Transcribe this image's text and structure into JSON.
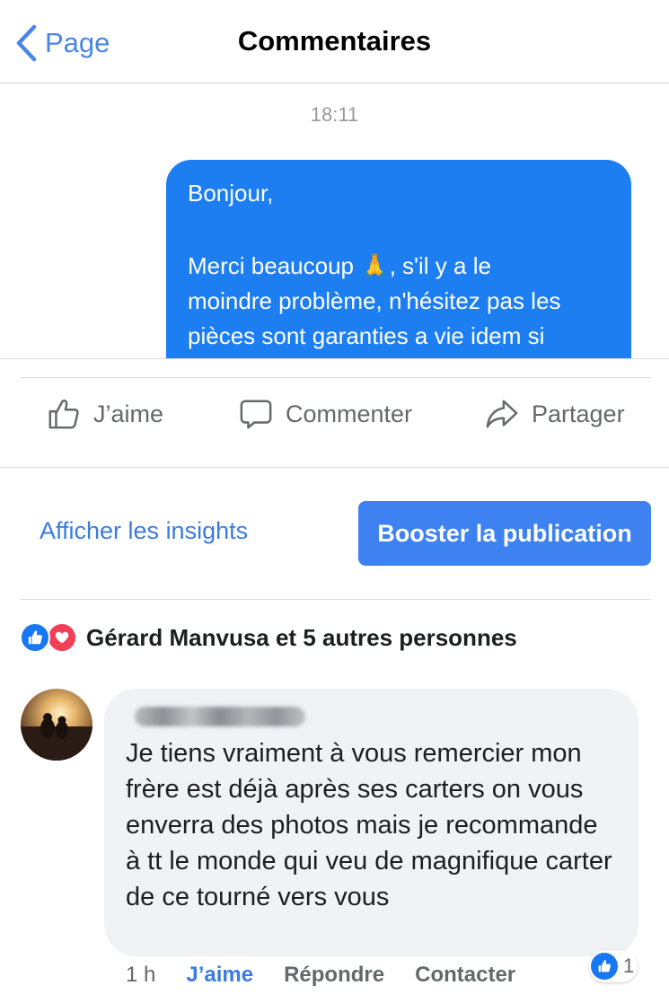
{
  "nav": {
    "back_label": "Page",
    "title": "Commentaires"
  },
  "preview": {
    "time": "18:11",
    "message_lines": [
      "Bonjour,",
      "Merci beaucoup 🙏, s'il y a le",
      "moindre problème, n'hésitez pas les",
      "pièces sont garanties a vie idem si"
    ]
  },
  "actions": {
    "like": "J’aime",
    "comment": "Commenter",
    "share": "Partager"
  },
  "insights_label": "Afficher les insights",
  "boost_label": "Booster la publication",
  "reactions": {
    "text": "Gérard Manvusa et 5 autres personnes"
  },
  "comment": {
    "text": "Je tiens vraiment à vous remercier mon frère est déjà après ses carters on vous enverra des photos mais je recommande à tt le monde qui veu de magnifique carter de ce tourné vers vous",
    "time_ago": "1 h",
    "like_label": "J’aime",
    "reply_label": "Répondre",
    "contact_label": "Contacter",
    "like_count": "1"
  },
  "colors": {
    "accent": "#3b7be0",
    "bubble": "#1d7ef2",
    "love": "#f33e58"
  }
}
